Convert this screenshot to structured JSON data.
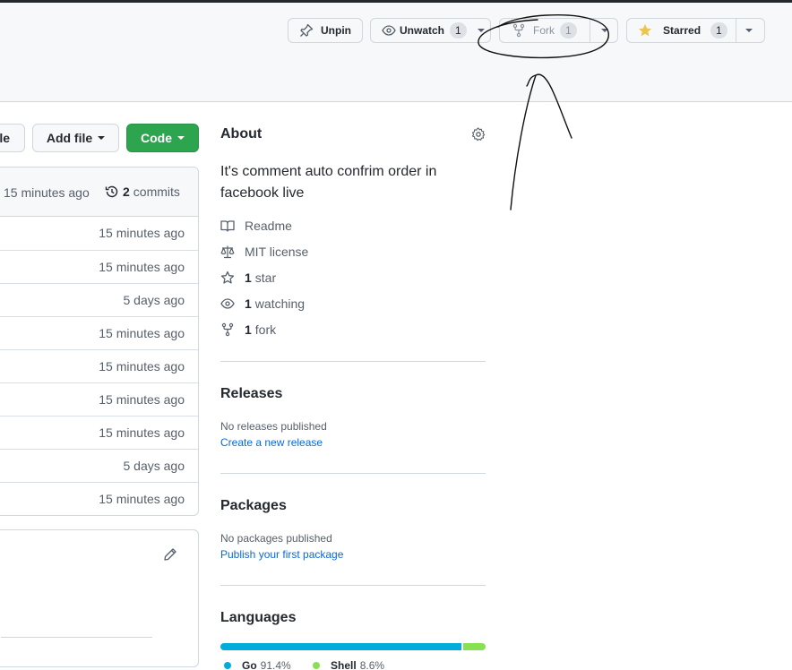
{
  "repo_actions": {
    "unpin_label": "Unpin",
    "unwatch_label": "Unwatch",
    "watch_count": "1",
    "fork_label": "Fork",
    "fork_count": "1",
    "star_label": "Starred",
    "star_count": "1"
  },
  "toolbar": {
    "partial_left_label": "le",
    "add_file_label": "Add file",
    "code_label": "Code"
  },
  "file_list": {
    "header_time": "15 minutes ago",
    "commits_count": "2",
    "commits_label": "commits",
    "rows": [
      {
        "time": "15 minutes ago"
      },
      {
        "time": "15 minutes ago"
      },
      {
        "time": "5 days ago"
      },
      {
        "time": "15 minutes ago"
      },
      {
        "time": "15 minutes ago"
      },
      {
        "time": "15 minutes ago"
      },
      {
        "time": "15 minutes ago"
      },
      {
        "time": "5 days ago"
      },
      {
        "time": "15 minutes ago"
      }
    ]
  },
  "about": {
    "heading": "About",
    "description_line1": "It's comment auto confrim order in",
    "description_line2": "facebook live",
    "readme": "Readme",
    "license": "MIT license",
    "stars_count": "1",
    "stars_label": "star",
    "watching_count": "1",
    "watching_label": "watching",
    "forks_count": "1",
    "forks_label": "fork"
  },
  "releases": {
    "heading": "Releases",
    "none_text": "No releases published",
    "link": "Create a new release"
  },
  "packages": {
    "heading": "Packages",
    "none_text": "No packages published",
    "link": "Publish your first package"
  },
  "languages": {
    "heading": "Languages",
    "items": [
      {
        "name": "Go",
        "percent": "91.4%",
        "value": 91.4,
        "color": "#00ADD8"
      },
      {
        "name": "Shell",
        "percent": "8.6%",
        "value": 8.6,
        "color": "#89e051"
      }
    ]
  },
  "colors": {
    "code_button": "#2da44e",
    "star_icon": "#eac54f",
    "link": "#0969da",
    "annotation_ink": "#111111"
  }
}
